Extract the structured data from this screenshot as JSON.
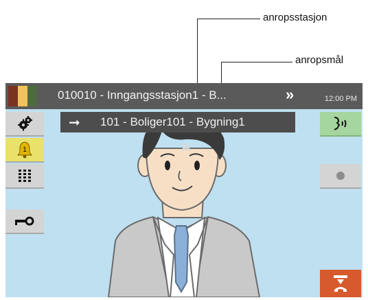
{
  "callouts": {
    "station_label": "anropsstasjon",
    "target_label": "anropsmål"
  },
  "topbar": {
    "title": "010010 - Inngangsstasjon1 - B...",
    "more_icon": "double-chevron-right-icon",
    "time": "12:00 PM"
  },
  "subbar": {
    "arrow_icon": "forward-arrow-icon",
    "target_text": "101 - Boliger101 - Bygning1"
  },
  "left_buttons": {
    "settings_icon": "gears-icon",
    "bell_badge": "1",
    "keypad_icon": "keypad-icon",
    "key_icon": "key-icon"
  },
  "right_buttons": {
    "talk_icon": "talk-icon",
    "record_icon": "record-icon",
    "hangup_icon": "hang-up-icon"
  },
  "colors": {
    "screen_bg": "#bfe0f0",
    "topbar_bg": "#5a5a5a",
    "talk_button": "#a5d6a0",
    "hangup_button": "#d65a2e"
  }
}
